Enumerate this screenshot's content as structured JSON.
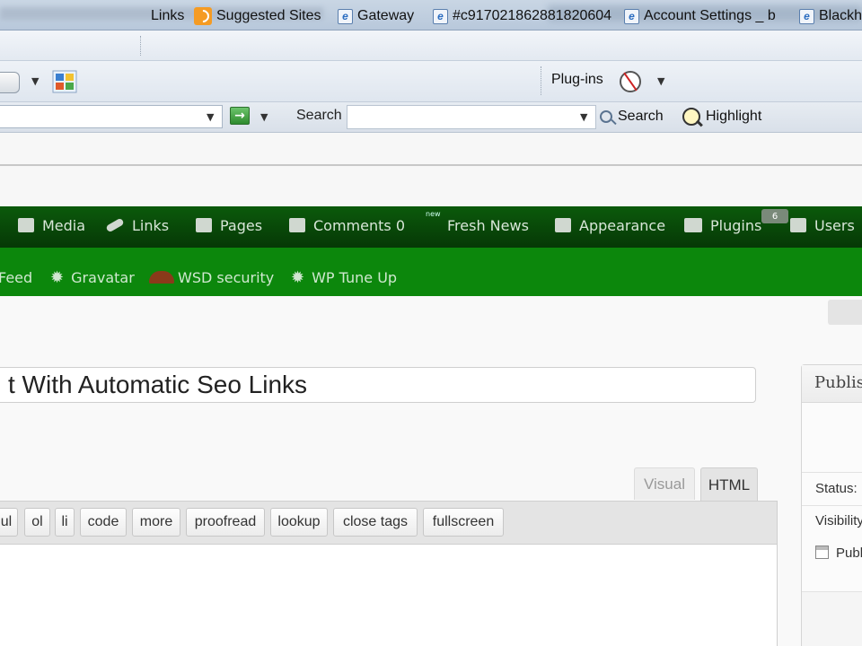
{
  "links_bar": {
    "label": "Links",
    "items": [
      {
        "label": "Suggested Sites",
        "icon": "rss-icon"
      },
      {
        "label": "Gateway",
        "icon": "ie-page-icon"
      },
      {
        "label": "#c917021862881820604",
        "icon": "ie-page-icon"
      },
      {
        "label": "Account Settings _ b",
        "icon": "ie-page-icon"
      },
      {
        "label": "Blackh",
        "icon": "ie-page-icon"
      }
    ]
  },
  "command_bar": {
    "plugins_label": "Plug-ins"
  },
  "address_bar": {
    "search_label": "Search",
    "search_value": "",
    "search_button": "Search",
    "highlight_button": "Highlight"
  },
  "admin_menu": {
    "items": [
      {
        "label": "Media"
      },
      {
        "label": "Links"
      },
      {
        "label": "Pages"
      },
      {
        "label": "Comments 0"
      },
      {
        "label": "Fresh News",
        "badge": "new"
      },
      {
        "label": "Appearance"
      },
      {
        "label": "Plugins"
      },
      {
        "label": "Users"
      }
    ],
    "plugins_count": "6"
  },
  "sub_menu": {
    "items": [
      {
        "label": "Feed"
      },
      {
        "label": "Gravatar"
      },
      {
        "label": "WSD security"
      },
      {
        "label": "WP Tune Up"
      }
    ]
  },
  "editor": {
    "title_value": "t With Automatic Seo Links",
    "tabs": {
      "visual": "Visual",
      "html": "HTML"
    },
    "quicktags": [
      "ul",
      "ol",
      "li",
      "code",
      "more",
      "proofread",
      "lookup",
      "close tags",
      "fullscreen"
    ]
  },
  "publish_panel": {
    "title": "Publish",
    "status_label": "Status:",
    "visibility_label": "Visibility",
    "publish_label": "Publish"
  },
  "colors": {
    "admin_bar": "#063806",
    "sub_menu": "#0c870c"
  }
}
